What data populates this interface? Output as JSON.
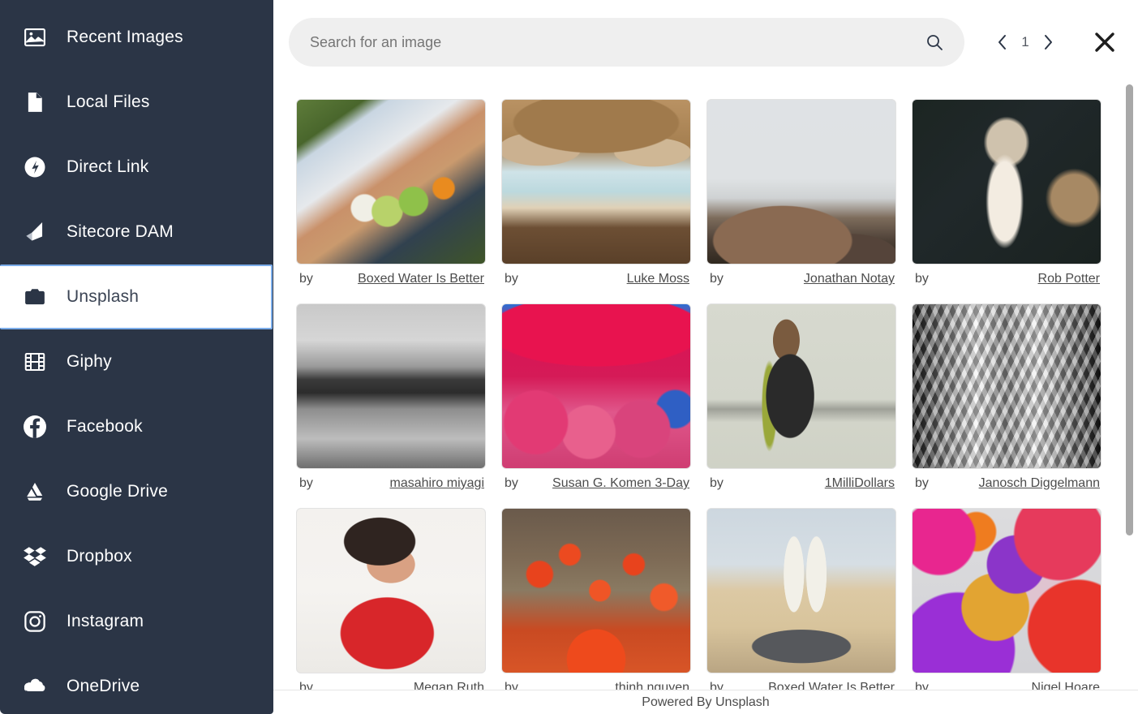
{
  "sidebar": {
    "items": [
      {
        "label": "Recent Images",
        "icon": "image-icon",
        "selected": false
      },
      {
        "label": "Local Files",
        "icon": "file-icon",
        "selected": false
      },
      {
        "label": "Direct Link",
        "icon": "link-icon",
        "selected": false
      },
      {
        "label": "Sitecore DAM",
        "icon": "sitecore-icon",
        "selected": false
      },
      {
        "label": "Unsplash",
        "icon": "camera-icon",
        "selected": true
      },
      {
        "label": "Giphy",
        "icon": "film-icon",
        "selected": false
      },
      {
        "label": "Facebook",
        "icon": "facebook-icon",
        "selected": false
      },
      {
        "label": "Google Drive",
        "icon": "google-drive-icon",
        "selected": false
      },
      {
        "label": "Dropbox",
        "icon": "dropbox-icon",
        "selected": false
      },
      {
        "label": "Instagram",
        "icon": "instagram-icon",
        "selected": false
      },
      {
        "label": "OneDrive",
        "icon": "onedrive-icon",
        "selected": false
      }
    ]
  },
  "topbar": {
    "search": {
      "value": "",
      "placeholder": "Search for an image",
      "icon": "search-icon"
    },
    "pager": {
      "prev_icon": "chevron-left-icon",
      "page": "1",
      "next_icon": "chevron-right-icon"
    },
    "close": {
      "icon": "close-icon"
    }
  },
  "grid": {
    "by_label": "by",
    "items": [
      {
        "author": "Boxed Water Is Better",
        "art": "a-picnic",
        "alt": "picnic-basket-photo"
      },
      {
        "author": "Luke Moss",
        "art": "a-umbrella",
        "alt": "beach-umbrellas-photo"
      },
      {
        "author": "Jonathan Notay",
        "art": "a-cliff",
        "alt": "foggy-cliff-photo"
      },
      {
        "author": "Rob Potter",
        "art": "a-llama",
        "alt": "llama-portrait-photo"
      },
      {
        "author": "masahiro miyagi",
        "art": "a-street",
        "alt": "street-reflection-photo"
      },
      {
        "author": "Susan G. Komen 3-Day",
        "art": "a-komen",
        "alt": "komen-walk-photo"
      },
      {
        "author": "1MilliDollars",
        "art": "a-portrait",
        "alt": "woman-braids-photo"
      },
      {
        "author": "Janosch Diggelmann",
        "art": "a-vault",
        "alt": "cathedral-vault-photo"
      },
      {
        "author": "Megan Ruth",
        "art": "a-red",
        "alt": "woman-red-outfit-photo"
      },
      {
        "author": "thinh nguyen",
        "art": "a-lantern",
        "alt": "red-lanterns-photo"
      },
      {
        "author": "Boxed Water Is Better",
        "art": "a-beach",
        "alt": "boxed-water-beach-photo"
      },
      {
        "author": "Nigel Hoare",
        "art": "a-gummy",
        "alt": "colorful-shapes-photo"
      }
    ]
  },
  "footer": {
    "text": "Powered By Unsplash"
  },
  "colors": {
    "sidebar_bg": "#2b3546",
    "selected_border": "#7badea",
    "search_bg": "#efefef",
    "scrollbar": "#a8a8a8"
  }
}
